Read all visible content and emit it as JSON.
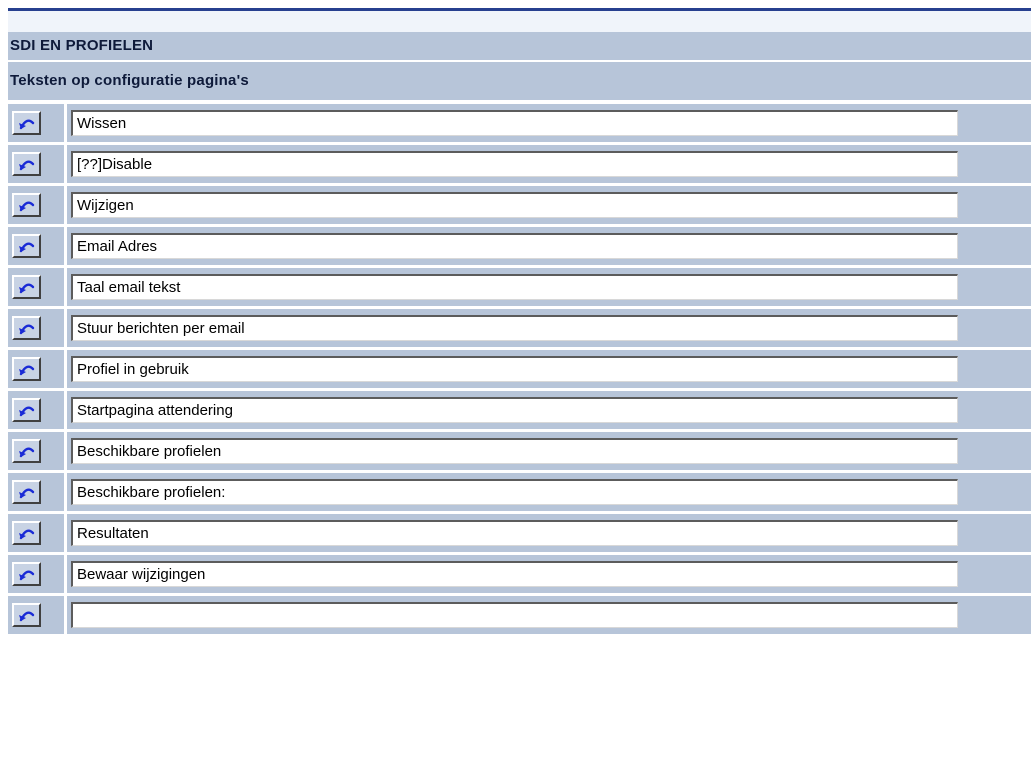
{
  "header": {
    "title": "SDI EN PROFIELEN",
    "subtitle": "Teksten op configuratie pagina's"
  },
  "colors": {
    "top_line": "#27408f",
    "band": "#b7c5d9",
    "revert_icon": "#1a2bd6"
  },
  "rows": [
    {
      "value": "Wissen",
      "icon": "undo-icon"
    },
    {
      "value": "[??]Disable",
      "icon": "undo-icon"
    },
    {
      "value": "Wijzigen",
      "icon": "undo-icon"
    },
    {
      "value": "Email Adres",
      "icon": "undo-icon"
    },
    {
      "value": "Taal email tekst",
      "icon": "undo-icon"
    },
    {
      "value": "Stuur berichten per email",
      "icon": "undo-icon"
    },
    {
      "value": "Profiel in gebruik",
      "icon": "undo-icon"
    },
    {
      "value": "Startpagina attendering",
      "icon": "undo-icon"
    },
    {
      "value": "Beschikbare profielen",
      "icon": "undo-icon"
    },
    {
      "value": "Beschikbare profielen:",
      "icon": "undo-icon"
    },
    {
      "value": "Resultaten",
      "icon": "undo-icon"
    },
    {
      "value": "Bewaar wijzigingen",
      "icon": "undo-icon"
    },
    {
      "value": "",
      "icon": "undo-icon"
    }
  ]
}
